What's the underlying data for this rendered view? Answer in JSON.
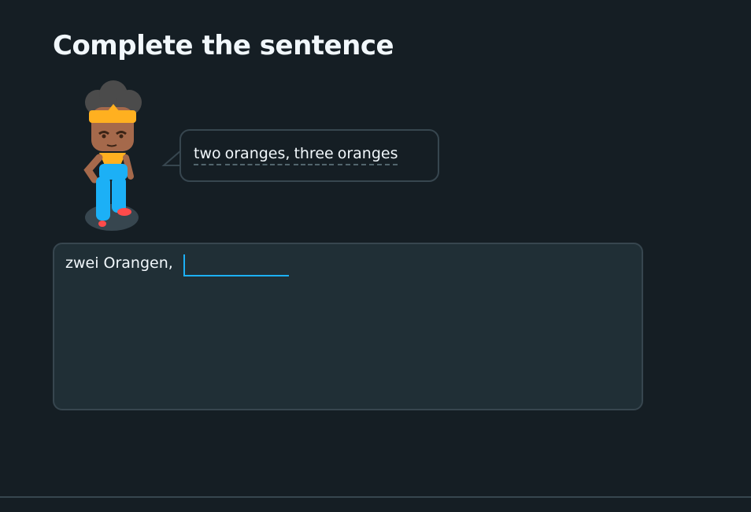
{
  "challenge": {
    "title": "Complete the sentence"
  },
  "prompt": {
    "words": [
      "two",
      "oranges,",
      "three",
      "oranges"
    ]
  },
  "answer": {
    "prefix": "zwei Orangen,",
    "value": "",
    "placeholder": ""
  },
  "colors": {
    "background": "#151e24",
    "box_background": "#202f36",
    "border": "#37464f",
    "accent": "#1cb0f6",
    "text": "#f1f7fb"
  },
  "icons": {
    "character": "character-illustration",
    "bubble_tail": "speech-bubble-tail"
  }
}
